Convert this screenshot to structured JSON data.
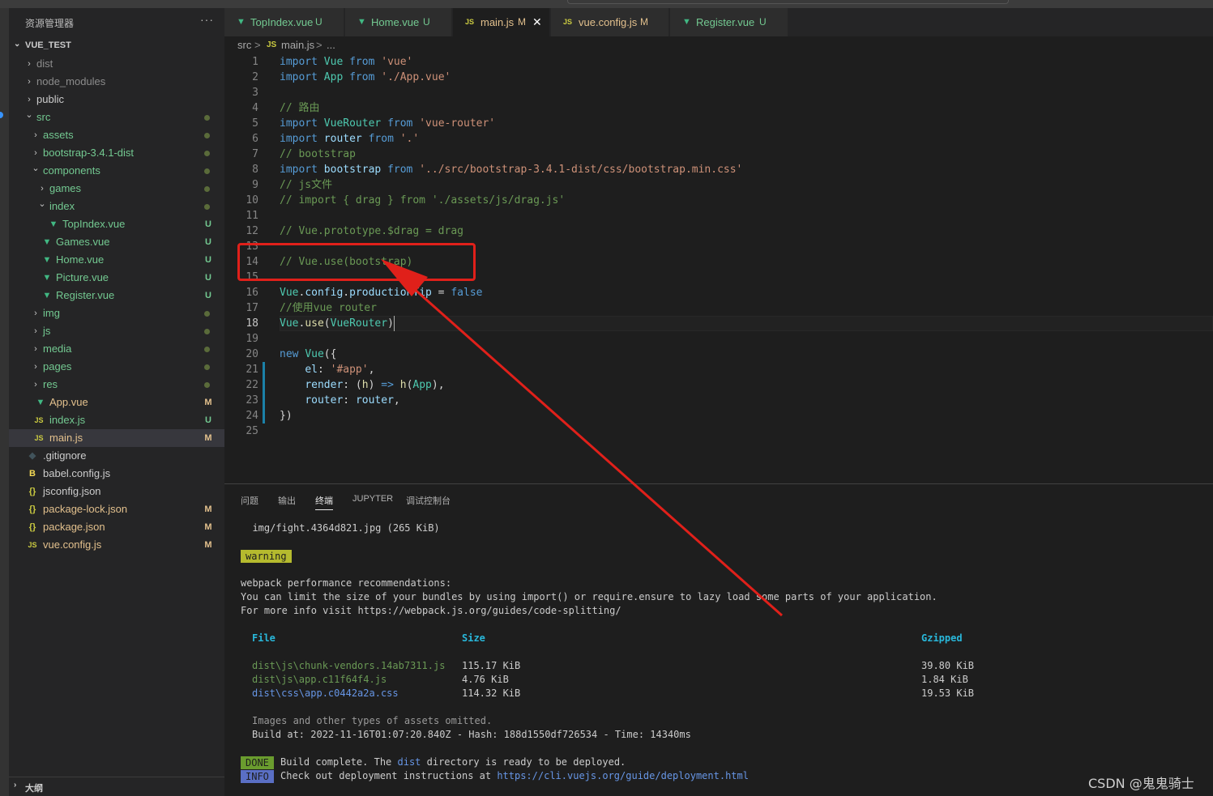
{
  "window": {
    "accent": "#007acc"
  },
  "sidebar": {
    "title": "资源管理器",
    "more": "···",
    "section": "VUE_TEST",
    "items": [
      {
        "name": "dist",
        "kind": "folder",
        "open": false,
        "depth": 0,
        "color": "#8c8c8c"
      },
      {
        "name": "node_modules",
        "kind": "folder",
        "open": false,
        "depth": 0,
        "color": "#8c8c8c"
      },
      {
        "name": "public",
        "kind": "folder",
        "open": false,
        "depth": 0,
        "color": "#cccccc"
      },
      {
        "name": "src",
        "kind": "folder",
        "open": true,
        "depth": 0,
        "color": "#73c991",
        "dot": true
      },
      {
        "name": "assets",
        "kind": "folder",
        "open": false,
        "depth": 1,
        "color": "#73c991",
        "dot": true
      },
      {
        "name": "bootstrap-3.4.1-dist",
        "kind": "folder",
        "open": false,
        "depth": 1,
        "color": "#73c991",
        "dot": true
      },
      {
        "name": "components",
        "kind": "folder",
        "open": true,
        "depth": 1,
        "color": "#73c991",
        "dot": true
      },
      {
        "name": "games",
        "kind": "folder",
        "open": false,
        "depth": 2,
        "color": "#73c991",
        "dot": true
      },
      {
        "name": "index",
        "kind": "folder",
        "open": true,
        "depth": 2,
        "color": "#73c991",
        "dot": true
      },
      {
        "name": "TopIndex.vue",
        "kind": "vue",
        "depth": 3,
        "color": "#73c991",
        "badge": "U"
      },
      {
        "name": "Games.vue",
        "kind": "vue",
        "depth": 2,
        "color": "#73c991",
        "badge": "U"
      },
      {
        "name": "Home.vue",
        "kind": "vue",
        "depth": 2,
        "color": "#73c991",
        "badge": "U"
      },
      {
        "name": "Picture.vue",
        "kind": "vue",
        "depth": 2,
        "color": "#73c991",
        "badge": "U"
      },
      {
        "name": "Register.vue",
        "kind": "vue",
        "depth": 2,
        "color": "#73c991",
        "badge": "U"
      },
      {
        "name": "img",
        "kind": "folder",
        "open": false,
        "depth": 1,
        "color": "#73c991",
        "dot": true
      },
      {
        "name": "js",
        "kind": "folder",
        "open": false,
        "depth": 1,
        "color": "#73c991",
        "dot": true
      },
      {
        "name": "media",
        "kind": "folder",
        "open": false,
        "depth": 1,
        "color": "#73c991",
        "dot": true
      },
      {
        "name": "pages",
        "kind": "folder",
        "open": false,
        "depth": 1,
        "color": "#73c991",
        "dot": true
      },
      {
        "name": "res",
        "kind": "folder",
        "open": false,
        "depth": 1,
        "color": "#73c991",
        "dot": true
      },
      {
        "name": "App.vue",
        "kind": "vue",
        "depth": 1,
        "color": "#e2c08d",
        "badge": "M"
      },
      {
        "name": "index.js",
        "kind": "js",
        "depth": 1,
        "color": "#73c991",
        "badge": "U"
      },
      {
        "name": "main.js",
        "kind": "js",
        "depth": 1,
        "color": "#e2c08d",
        "badge": "M",
        "selected": true
      },
      {
        "name": ".gitignore",
        "kind": "git",
        "depth": 0,
        "color": "#cccccc"
      },
      {
        "name": "babel.config.js",
        "kind": "babel",
        "depth": 0,
        "color": "#cccccc"
      },
      {
        "name": "jsconfig.json",
        "kind": "json",
        "depth": 0,
        "color": "#cccccc"
      },
      {
        "name": "package-lock.json",
        "kind": "json",
        "depth": 0,
        "color": "#e2c08d",
        "badge": "M"
      },
      {
        "name": "package.json",
        "kind": "json",
        "depth": 0,
        "color": "#e2c08d",
        "badge": "M"
      },
      {
        "name": "vue.config.js",
        "kind": "js",
        "depth": 0,
        "color": "#e2c08d",
        "badge": "M"
      }
    ],
    "outline": "大纲"
  },
  "tabs": [
    {
      "name": "TopIndex.vue",
      "kind": "vue",
      "status": "U",
      "color": "#73c991"
    },
    {
      "name": "Home.vue",
      "kind": "vue",
      "status": "U",
      "color": "#73c991"
    },
    {
      "name": "main.js",
      "kind": "js",
      "status": "M",
      "color": "#e2c08d",
      "active": true,
      "close": "✕"
    },
    {
      "name": "vue.config.js",
      "kind": "js",
      "status": "M",
      "color": "#e2c08d"
    },
    {
      "name": "Register.vue",
      "kind": "vue",
      "status": "U",
      "color": "#73c991"
    }
  ],
  "breadcrumb": {
    "folder": "src",
    "sep": ">",
    "file": "main.js",
    "tail": "..."
  },
  "code": {
    "line_numbers": [
      "1",
      "2",
      "3",
      "4",
      "5",
      "6",
      "7",
      "8",
      "9",
      "10",
      "11",
      "12",
      "13",
      "14",
      "15",
      "16",
      "17",
      "18",
      "19",
      "20",
      "21",
      "22",
      "23",
      "24",
      "25"
    ],
    "lines": [
      "import Vue from 'vue'",
      "import App from './App.vue'",
      "",
      "// 路由",
      "import VueRouter from 'vue-router'",
      "import router from '.'",
      "// bootstrap",
      "import bootstrap from '../src/bootstrap-3.4.1-dist/css/bootstrap.min.css'",
      "// js文件",
      "// import { drag } from './assets/js/drag.js'",
      "",
      "// Vue.prototype.$drag = drag",
      "",
      "// Vue.use(bootstrap)",
      "",
      "Vue.config.productionTip = false",
      "//使用vue router",
      "Vue.use(VueRouter)",
      "",
      "new Vue({",
      "    el: '#app',",
      "    render: (h) => h(App),",
      "    router: router,",
      "})",
      ""
    ]
  },
  "panel": {
    "tabs": [
      "问题",
      "输出",
      "终端",
      "JUPYTER",
      "调试控制台"
    ],
    "active_tab": "终端",
    "img_line": "  img/fight.4364d821.jpg (265 KiB)",
    "warning": "warning",
    "perf1": "webpack performance recommendations:",
    "perf2": "You can limit the size of your bundles by using import() or require.ensure to lazy load some parts of your application.",
    "perf3": "For more info visit https://webpack.js.org/guides/code-splitting/",
    "headers": {
      "file": "File",
      "size": "Size",
      "gzip": "Gzipped"
    },
    "assets": [
      {
        "file": "dist\\js\\chunk-vendors.14ab7311.js",
        "size": "115.17 KiB",
        "gzip": "39.80 KiB",
        "color": "#6a9955"
      },
      {
        "file": "dist\\js\\app.c11f64f4.js",
        "size": "4.76 KiB",
        "gzip": "1.84 KiB",
        "color": "#6a9955"
      },
      {
        "file": "dist\\css\\app.c0442a2a.css",
        "size": "114.32 KiB",
        "gzip": "19.53 KiB",
        "color": "#6796e6"
      }
    ],
    "omitted": "Images and other types of assets omitted.",
    "build_at": "Build at: 2022-11-16T01:07:20.840Z - Hash: 188d1550df726534 - Time: 14340ms",
    "done_badge": "DONE",
    "done_pre": "Build complete. The ",
    "done_dist": "dist",
    "done_post": " directory is ready to be deployed.",
    "info_badge": "INFO",
    "info_pre": "Check out deployment instructions at ",
    "info_url": "https://cli.vuejs.org/guide/deployment.html"
  },
  "watermark": "CSDN @鬼鬼骑士"
}
